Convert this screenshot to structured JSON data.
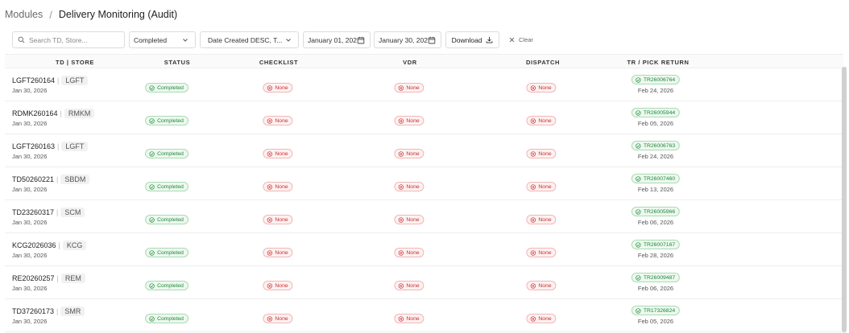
{
  "breadcrumb": {
    "root": "Modules",
    "separator": "/",
    "current": "Delivery Monitoring (Audit)"
  },
  "toolbar": {
    "search_placeholder": "Search TD, Store...",
    "status_value": "Completed",
    "sort_value": "Date Created DESC, T...",
    "date_from": "January 01, 202",
    "date_to": "January 30, 202",
    "download_label": "Download",
    "clear_label": "Clear"
  },
  "columns": [
    "TD | STORE",
    "STATUS",
    "CHECKLIST",
    "VDR",
    "DISPATCH",
    "TR / PICK RETURN"
  ],
  "rows": [
    {
      "td": "LGFT260164",
      "store": "LGFT",
      "date": "Jan 30, 2026",
      "status": "Completed",
      "checklist": "None",
      "vdr": "None",
      "dispatch": "None",
      "tr": "TR26006764",
      "tr_date": "Feb 24, 2026"
    },
    {
      "td": "RDMK260164",
      "store": "RMKM",
      "date": "Jan 30, 2026",
      "status": "Completed",
      "checklist": "None",
      "vdr": "None",
      "dispatch": "None",
      "tr": "TR26005944",
      "tr_date": "Feb 05, 2026"
    },
    {
      "td": "LGFT260163",
      "store": "LGFT",
      "date": "Jan 30, 2026",
      "status": "Completed",
      "checklist": "None",
      "vdr": "None",
      "dispatch": "None",
      "tr": "TR26006763",
      "tr_date": "Feb 24, 2026"
    },
    {
      "td": "TD50260221",
      "store": "SBDM",
      "date": "Jan 30, 2026",
      "status": "Completed",
      "checklist": "None",
      "vdr": "None",
      "dispatch": "None",
      "tr": "TR26007460",
      "tr_date": "Feb 13, 2026"
    },
    {
      "td": "TD23260317",
      "store": "SCM",
      "date": "Jan 30, 2026",
      "status": "Completed",
      "checklist": "None",
      "vdr": "None",
      "dispatch": "None",
      "tr": "TR26005966",
      "tr_date": "Feb 06, 2026"
    },
    {
      "td": "KCG2026036",
      "store": "KCG",
      "date": "Jan 30, 2026",
      "status": "Completed",
      "checklist": "None",
      "vdr": "None",
      "dispatch": "None",
      "tr": "TR26007167",
      "tr_date": "Feb 28, 2026"
    },
    {
      "td": "RE20260257",
      "store": "REM",
      "date": "Jan 30, 2026",
      "status": "Completed",
      "checklist": "None",
      "vdr": "None",
      "dispatch": "None",
      "tr": "TR26009487",
      "tr_date": "Feb 06, 2026"
    },
    {
      "td": "TD37260173",
      "store": "SMR",
      "date": "Jan 30, 2026",
      "status": "Completed",
      "checklist": "None",
      "vdr": "None",
      "dispatch": "None",
      "tr": "TR17326824",
      "tr_date": "Feb 05, 2026"
    }
  ],
  "icons": {
    "search": "search-icon",
    "chevron": "chevron-down-icon",
    "calendar": "calendar-icon",
    "download": "download-icon",
    "clear": "close-icon",
    "completed": "check-circle-icon",
    "none": "x-circle-icon"
  },
  "colors": {
    "completed": "#1f8a3a",
    "none": "#cc2e2e"
  }
}
